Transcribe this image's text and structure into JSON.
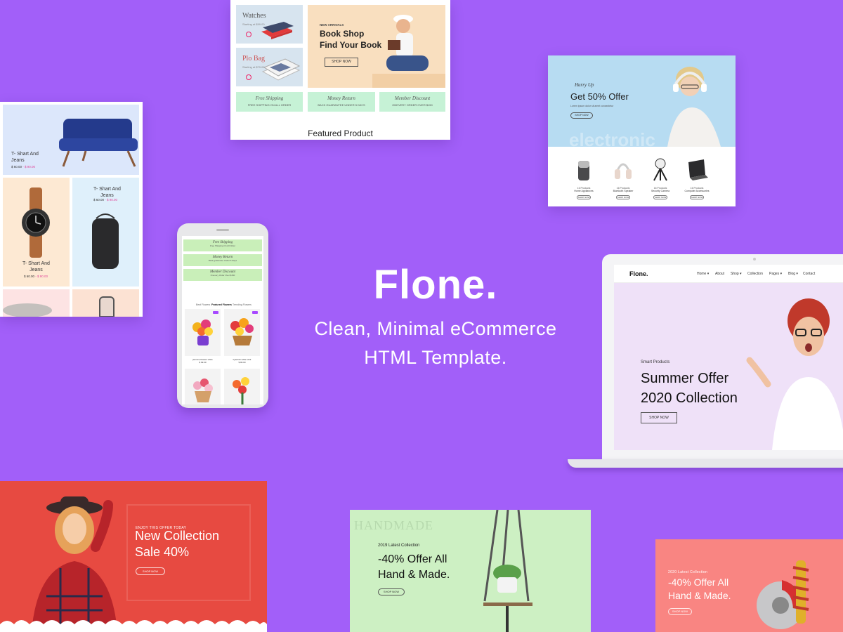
{
  "hero": {
    "title": "Flone.",
    "subtitle_line1": "Clean, Minimal eCommerce",
    "subtitle_line2": "HTML Template."
  },
  "book_shop": {
    "banners": [
      {
        "title": "Watches",
        "subtitle": "Starting at $99.00"
      },
      {
        "title": "Plo Bag",
        "subtitle": "Starting at $79.00"
      }
    ],
    "hero_kicker": "NEW ARRIVALS",
    "hero_line1": "Book Shop",
    "hero_line2": "Find Your Book",
    "hero_button": "SHOP NOW",
    "promos": [
      {
        "title": "Free Shipping",
        "sub": "FREE SHIPPING ON ALL ORDER"
      },
      {
        "title": "Money Return",
        "sub": "BACK GUARANTEE UNDER 5 DAYS"
      },
      {
        "title": "Member Discount",
        "sub": "ONEVERY ORDER OVER $150"
      }
    ],
    "featured": "Featured Product"
  },
  "fashion": {
    "tiles": [
      {
        "title_line1": "T- Shart And",
        "title_line2": "Jeans",
        "price": "$ 60.00",
        "old_price": "- $ 90.00"
      },
      {
        "title_line1": "T- Shart And",
        "title_line2": "Jeans",
        "price": "$ 60.00",
        "old_price": "- $ 90.00"
      },
      {
        "title_line1": "T- Shart And",
        "title_line2": "Jeans",
        "price": "$ 60.00",
        "old_price": "- $ 90.00"
      }
    ]
  },
  "electronics": {
    "kicker": "Hurry Up",
    "headline": "Get 50% Offer",
    "blurb": "Lorem ipsum dolor sit amet consectetur",
    "button": "SHOP NOW",
    "watermark": "electronic",
    "products": [
      {
        "count": "16 Products",
        "name": "Home Appliances",
        "button": "SHOP NOW"
      },
      {
        "count": "16 Products",
        "name": "Bluetooth Speaker",
        "button": "SHOP NOW"
      },
      {
        "count": "16 Products",
        "name": "Security Camera",
        "button": "SHOP NOW"
      },
      {
        "count": "16 Products",
        "name": "Computer Accessories",
        "button": "SHOP NOW"
      }
    ]
  },
  "phone": {
    "promos": [
      {
        "title": "Free Shipping",
        "sub": "Free Shipping On All Order"
      },
      {
        "title": "Money Return",
        "sub": "Back guarantee Under 5 Days"
      },
      {
        "title": "Member Discount",
        "sub": "Onevery Order Over $150"
      }
    ],
    "tabs": [
      "Best Flowers",
      "Featured Flowers",
      "Trending Flowers"
    ],
    "products": [
      {
        "name": "jasmine flowers white",
        "price": "$ 99.00"
      },
      {
        "name": "hyacinth white stick",
        "price": "$ 99.00"
      }
    ]
  },
  "laptop": {
    "logo": "Flone.",
    "menu": [
      "Home",
      "About",
      "Shop",
      "Collection",
      "Pages",
      "Blog",
      "Contact"
    ],
    "kicker": "Smart Products",
    "line1": "Summer Offer",
    "line2": "2020 Collection",
    "button": "SHOP NOW"
  },
  "red_banner": {
    "kicker": "ENJOY THIS OFFER TODAY",
    "line1": "New Collection",
    "line2": "Sale 40%",
    "button": "SHOP NOW"
  },
  "green_banner": {
    "watermark": "HANDMADE",
    "kicker": "2019 Latest Collection",
    "line1": "-40% Offer All",
    "line2": "Hand & Made.",
    "button": "SHOP NOW"
  },
  "salmon_banner": {
    "kicker": "2020 Latest Collection",
    "line1": "-40% Offer All",
    "line2": "Hand & Made.",
    "button": "SHOP NOW"
  },
  "colors": {
    "background": "#a25ff9",
    "accent": "#a749ff",
    "red_banner": "#e74a41",
    "green_banner": "#cdf0c3",
    "salmon_banner": "#f98582"
  }
}
